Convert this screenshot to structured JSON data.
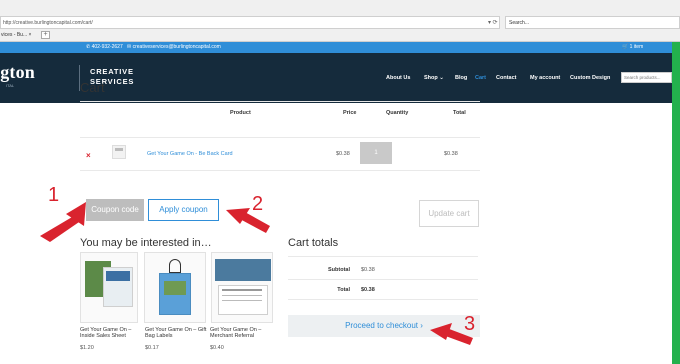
{
  "browser": {
    "url": "http://creative.burlingtoncapital.com/cart/",
    "url_controls": "▾ ⟳",
    "search_label": "Search...",
    "tab_title": "vices - Bu...  ×",
    "new_tab": "+"
  },
  "topbar": {
    "phone": "402-932-2627",
    "email": "creativeservices@burlingtoncapital.com",
    "cart": "1 item"
  },
  "header": {
    "logo_text": "ngton",
    "logo_sub": "ITAL",
    "tagline_line1": "CREATIVE",
    "tagline_line2": "SERVICES",
    "nav": [
      "About Us",
      "Shop ⌄",
      "Blog",
      "Cart",
      "Contact",
      "My account",
      "Custom Design"
    ],
    "search_placeholder": "Search products..."
  },
  "cart": {
    "title": "Cart",
    "headers": {
      "product": "Product",
      "price": "Price",
      "quantity": "Quantity",
      "total": "Total"
    },
    "item": {
      "remove": "×",
      "name": "Get Your Game On - Be Back Card",
      "price": "$0.38",
      "quantity": "1",
      "total": "$0.38"
    },
    "coupon_placeholder": "Coupon code",
    "apply_coupon": "Apply coupon",
    "update_cart": "Update cart"
  },
  "upsells": {
    "title": "You may be interested in…",
    "items": [
      {
        "name_line1": "Get Your Game On –",
        "name_line2": "Inside Sales Sheet",
        "price": "$1.20"
      },
      {
        "name_line1": "Get Your Game On – Gift",
        "name_line2": "Bag Labels",
        "price": "$0.17"
      },
      {
        "name_line1": "Get Your Game On –",
        "name_line2": "Merchant Referral",
        "price": "$0.40"
      }
    ]
  },
  "totals": {
    "title": "Cart totals",
    "subtotal_label": "Subtotal",
    "subtotal": "$0.38",
    "total_label": "Total",
    "total": "$0.38",
    "checkout": "Proceed to checkout  ›"
  },
  "annotations": {
    "n1": "1",
    "n2": "2",
    "n3": "3",
    "color": "#d9232e"
  },
  "colors": {
    "frame": "#23b14d",
    "accent": "#2f8ed8",
    "header_bg": "#152b3c"
  }
}
